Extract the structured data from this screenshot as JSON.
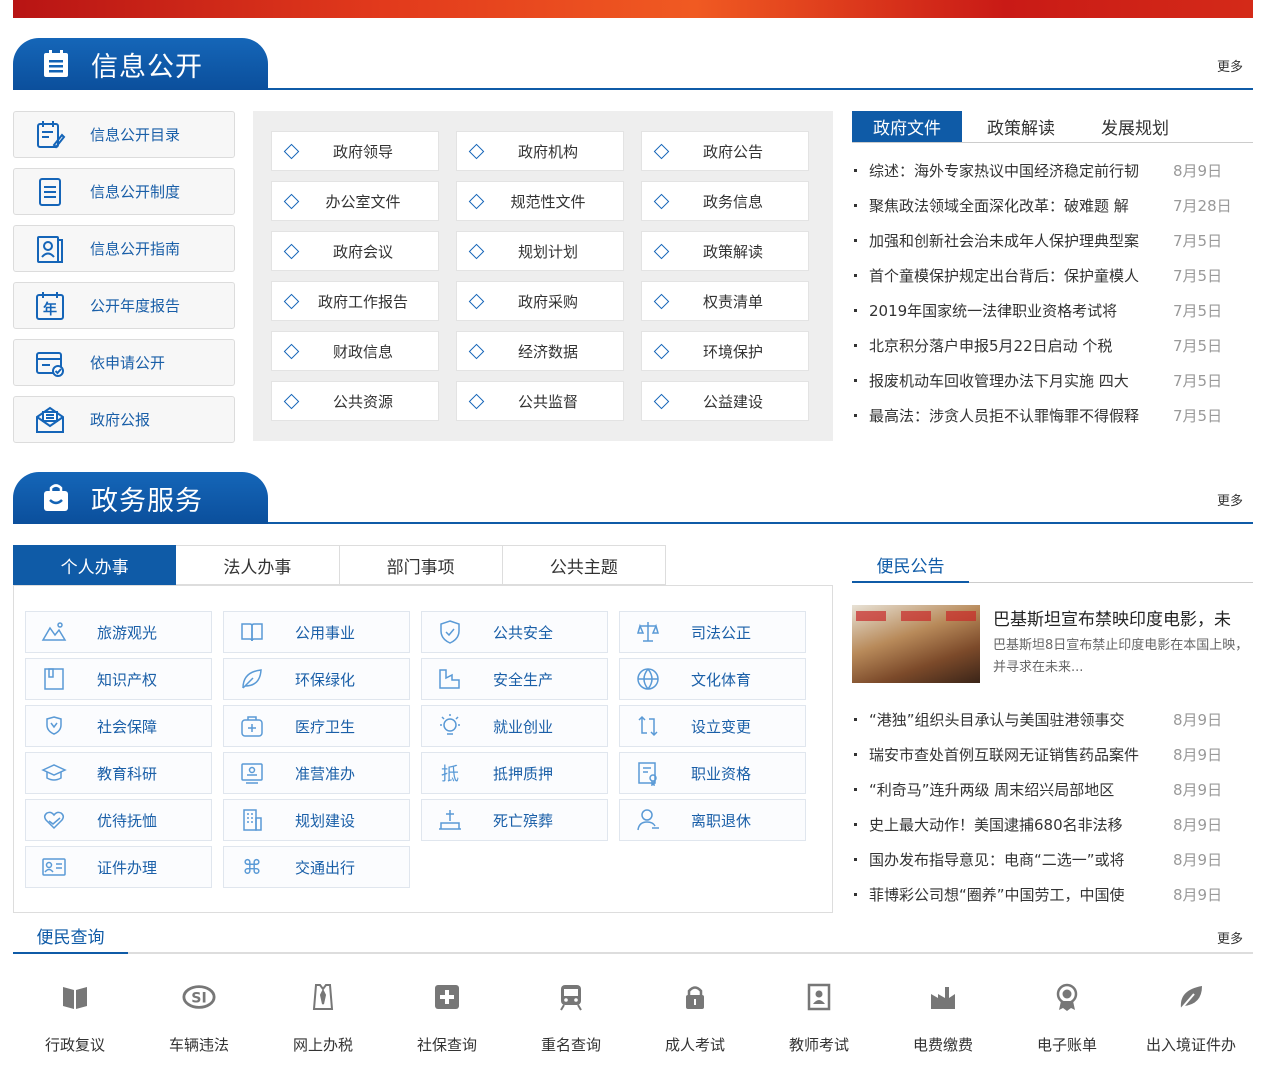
{
  "info_section": {
    "title": "信息公开",
    "more": "更多",
    "menu": [
      {
        "label": "信息公开目录",
        "icon": "catalog-edit-icon"
      },
      {
        "label": "信息公开制度",
        "icon": "document-icon"
      },
      {
        "label": "信息公开指南",
        "icon": "guide-book-icon"
      },
      {
        "label": "公开年度报告",
        "icon": "annual-calendar-icon"
      },
      {
        "label": "依申请公开",
        "icon": "application-card-icon"
      },
      {
        "label": "政府公报",
        "icon": "bulletin-mail-icon"
      }
    ],
    "grid": [
      "政府领导",
      "政府机构",
      "政府公告",
      "办公室文件",
      "规范性文件",
      "政务信息",
      "政府会议",
      "规划计划",
      "政策解读",
      "政府工作报告",
      "政府采购",
      "权责清单",
      "财政信息",
      "经济数据",
      "环境保护",
      "公共资源",
      "公共监督",
      "公益建设"
    ],
    "news_tabs": [
      "政府文件",
      "政策解读",
      "发展规划"
    ],
    "news": [
      {
        "title": "综述：海外专家热议中国经济稳定前行韧",
        "date": "8月9日"
      },
      {
        "title": "聚焦政法领域全面深化改革：破难题 解",
        "date": "7月28日"
      },
      {
        "title": "加强和创新社会治未成年人保护理典型案",
        "date": "7月5日"
      },
      {
        "title": "首个童模保护规定出台背后：保护童模人",
        "date": "7月5日"
      },
      {
        "title": "2019年国家统一法律职业资格考试将",
        "date": "7月5日"
      },
      {
        "title": "北京积分落户申报5月22日启动 个税",
        "date": "7月5日"
      },
      {
        "title": "报废机动车回收管理办法下月实施 四大",
        "date": "7月5日"
      },
      {
        "title": "最高法：涉贪人员拒不认罪悔罪不得假释",
        "date": "7月5日"
      }
    ]
  },
  "service_section": {
    "title": "政务服务",
    "more": "更多",
    "tabs": [
      "个人办事",
      "法人办事",
      "部门事项",
      "公共主题"
    ],
    "items": [
      {
        "label": "旅游观光",
        "icon": "mountain-icon"
      },
      {
        "label": "公用事业",
        "icon": "book-open-icon"
      },
      {
        "label": "公共安全",
        "icon": "shield-check-icon"
      },
      {
        "label": "司法公正",
        "icon": "scales-icon"
      },
      {
        "label": "知识产权",
        "icon": "book-mark-icon"
      },
      {
        "label": "环保绿化",
        "icon": "leaf-icon"
      },
      {
        "label": "安全生产",
        "icon": "factory-icon"
      },
      {
        "label": "文化体育",
        "icon": "basketball-icon"
      },
      {
        "label": "社会保障",
        "icon": "shield-icon"
      },
      {
        "label": "医疗卫生",
        "icon": "medical-kit-icon"
      },
      {
        "label": "就业创业",
        "icon": "lightbulb-icon"
      },
      {
        "label": "设立变更",
        "icon": "refresh-icon"
      },
      {
        "label": "教育科研",
        "icon": "graduation-cap-icon"
      },
      {
        "label": "准营准办",
        "icon": "id-card-icon"
      },
      {
        "label": "抵押质押",
        "icon": "pledge-icon"
      },
      {
        "label": "职业资格",
        "icon": "certificate-icon"
      },
      {
        "label": "优待抚恤",
        "icon": "heart-hand-icon"
      },
      {
        "label": "规划建设",
        "icon": "building-icon"
      },
      {
        "label": "死亡殡葬",
        "icon": "tomb-icon"
      },
      {
        "label": "离职退休",
        "icon": "person-icon"
      },
      {
        "label": "证件办理",
        "icon": "id-document-icon"
      },
      {
        "label": "交通出行",
        "icon": "command-icon"
      }
    ]
  },
  "notice": {
    "tab": "便民公告",
    "feature": {
      "title": "巴基斯坦宣布禁映印度电影，未",
      "desc": "巴基斯坦8日宣布禁止印度电影在本国上映，并寻求在未来..."
    },
    "news": [
      {
        "title": "“港独”组织头目承认与美国驻港领事交",
        "date": "8月9日"
      },
      {
        "title": "瑞安市查处首例互联网无证销售药品案件",
        "date": "8月9日"
      },
      {
        "title": "“利奇马”连升两级 周末绍兴局部地区",
        "date": "8月9日"
      },
      {
        "title": "史上最大动作！美国逮捕680名非法移",
        "date": "8月9日"
      },
      {
        "title": "国办发布指导意见：电商“二选一”或将",
        "date": "8月9日"
      },
      {
        "title": "菲博彩公司想“圈养”中国劳工，中国使",
        "date": "8月9日"
      }
    ]
  },
  "query": {
    "tab": "便民查询",
    "more": "更多",
    "items": [
      {
        "label": "行政复议",
        "icon": "book-icon"
      },
      {
        "label": "车辆违法",
        "icon": "si-logo-icon"
      },
      {
        "label": "网上办税",
        "icon": "shirt-tie-icon"
      },
      {
        "label": "社保查询",
        "icon": "plus-box-icon"
      },
      {
        "label": "重名查询",
        "icon": "train-icon"
      },
      {
        "label": "成人考试",
        "icon": "lock-icon"
      },
      {
        "label": "教师考试",
        "icon": "person-card-icon"
      },
      {
        "label": "电费缴费",
        "icon": "factory-icon"
      },
      {
        "label": "电子账单",
        "icon": "award-icon"
      },
      {
        "label": "出入境证件办",
        "icon": "leaf-icon"
      }
    ]
  },
  "colors": {
    "primary": "#0f5ba7",
    "link": "#1a5fa8",
    "banner": "#d42a18"
  }
}
